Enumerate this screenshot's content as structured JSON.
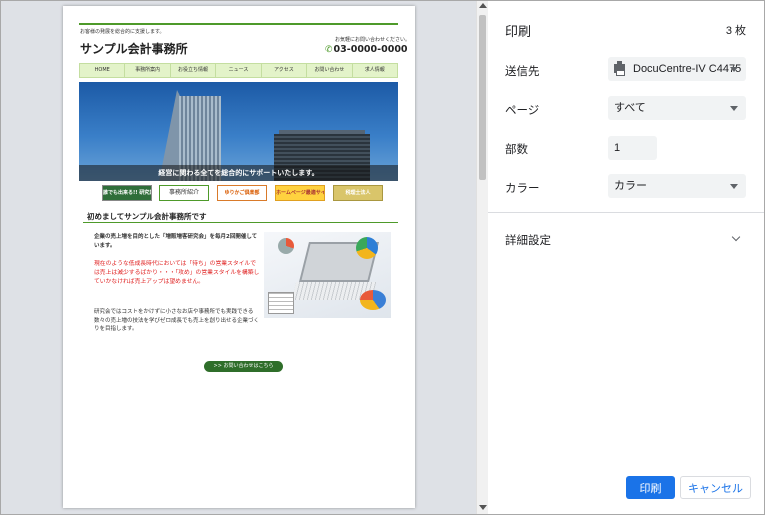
{
  "preview": {
    "tagline": "お客様の発展を総合的に支援します。",
    "site_title": "サンプル会計事務所",
    "contact_note": "お気軽にお問い合わせください。",
    "phone": "03-0000-0000",
    "nav": [
      "HOME",
      "事務所案内",
      "お役立ち情報",
      "ニュース",
      "アクセス",
      "お問い合わせ",
      "求人情報"
    ],
    "hero_caption": "経営に関わる全てを総合的にサポートいたします。",
    "banners": [
      "誰でも出来る!!\n研究業務集客講座",
      "事務所紹介",
      "ゆりかご倶楽部",
      "ホームページ最適サイト 極めし",
      "税理士法人"
    ],
    "section_title": "初めましてサンプル会計事務所です",
    "para_1": "企業の売上増を目的とした「増販増客研究会」を毎月2回開催しています。",
    "para_2": "現在のような低成長時代においては「待ち」の営業スタイルでは売上は減少するばかり・・・「攻め」の営業スタイルを構築していかなければ売上アップは望めません。",
    "para_3": "研究会ではコストをかけずに小さなお店や事務所でも実践できる数々の売上増の技法を学びゼロ成長でも売上を創り出せる企業づくりを目指します。",
    "contact_button": ">> お問い合わせはこちら"
  },
  "settings": {
    "title": "印刷",
    "sheet_count": "3 枚",
    "destination": {
      "label": "送信先",
      "value": "DocuCentre-IV C4475"
    },
    "pages": {
      "label": "ページ",
      "value": "すべて"
    },
    "copies": {
      "label": "部数",
      "value": "1"
    },
    "color": {
      "label": "カラー",
      "value": "カラー"
    },
    "more_settings": "詳細設定"
  },
  "buttons": {
    "print": "印刷",
    "cancel": "キャンセル"
  },
  "colors": {
    "accent": "#1a73e8",
    "site_green": "#4e9a2a",
    "panel_bg": "#dee1e6"
  }
}
